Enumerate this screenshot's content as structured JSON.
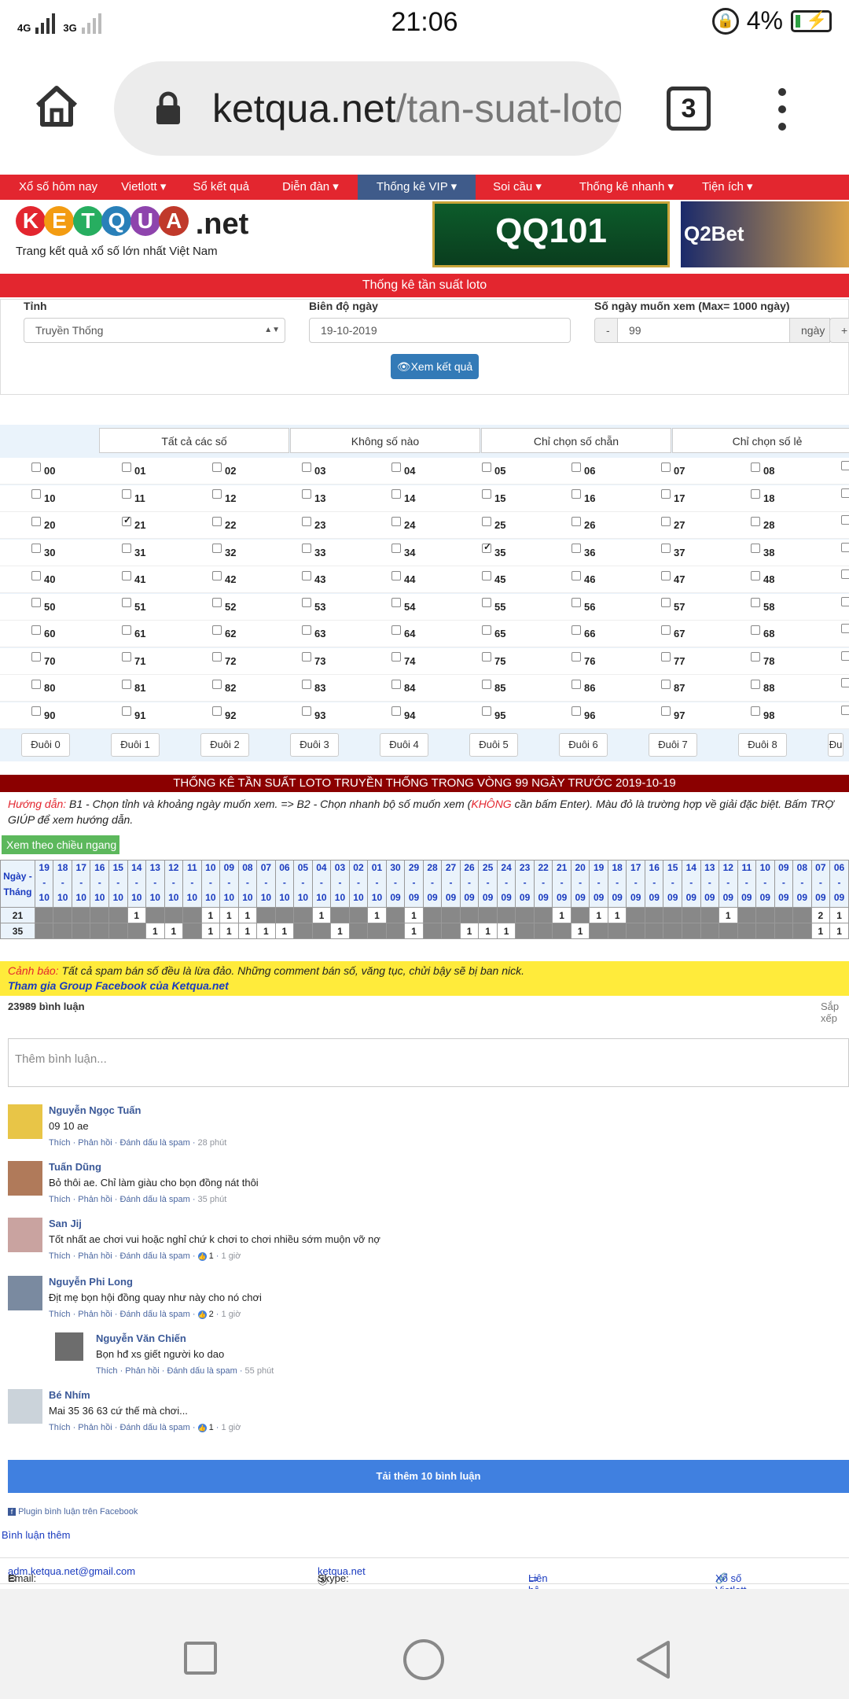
{
  "status_bar": {
    "network": "4G 3G",
    "time": "21:06",
    "battery": "4%"
  },
  "browser": {
    "url_host": "ketqua.net",
    "url_path": "/tan-suat-loto",
    "tab_count": "3"
  },
  "nav": [
    "Xổ số hôm nay",
    "Vietlott",
    "Sổ kết quả",
    "Diễn đàn",
    "Thống kê VIP",
    "Soi cầu",
    "Thống kê nhanh",
    "Tiện ích"
  ],
  "logo": {
    "letters": [
      "K",
      "E",
      "T",
      "Q",
      "U",
      "A"
    ],
    "suffix": ".net",
    "tagline": "Trang kết quả xổ số lớn nhất Việt Nam"
  },
  "ads": {
    "ad1": "QQ101",
    "ad2": "Q2Bet"
  },
  "page_title": "Thống kê tần suất loto",
  "form": {
    "province_label": "Tỉnh",
    "province_value": "Truyền Thống",
    "date_label": "Biên độ ngày",
    "date_value": "19-10-2019",
    "days_label": "Số ngày muốn xem (Max= 1000 ngày)",
    "days_value": "99",
    "minus": "-",
    "plus": "+",
    "unit": "ngày",
    "submit": "Xem kết quả"
  },
  "grid_header": [
    "Tất cả các số",
    "Không số nào",
    "Chỉ chọn số chẵn",
    "Chỉ chọn số lẻ"
  ],
  "numbers": [
    [
      "00",
      "01",
      "02",
      "03",
      "04",
      "05",
      "06",
      "07",
      "08"
    ],
    [
      "10",
      "11",
      "12",
      "13",
      "14",
      "15",
      "16",
      "17",
      "18"
    ],
    [
      "20",
      "21",
      "22",
      "23",
      "24",
      "25",
      "26",
      "27",
      "28"
    ],
    [
      "30",
      "31",
      "32",
      "33",
      "34",
      "35",
      "36",
      "37",
      "38"
    ],
    [
      "40",
      "41",
      "42",
      "43",
      "44",
      "45",
      "46",
      "47",
      "48"
    ],
    [
      "50",
      "51",
      "52",
      "53",
      "54",
      "55",
      "56",
      "57",
      "58"
    ],
    [
      "60",
      "61",
      "62",
      "63",
      "64",
      "65",
      "66",
      "67",
      "68"
    ],
    [
      "70",
      "71",
      "72",
      "73",
      "74",
      "75",
      "76",
      "77",
      "78"
    ],
    [
      "80",
      "81",
      "82",
      "83",
      "84",
      "85",
      "86",
      "87",
      "88"
    ],
    [
      "90",
      "91",
      "92",
      "93",
      "94",
      "95",
      "96",
      "97",
      "98"
    ]
  ],
  "checked": [
    "21",
    "35"
  ],
  "duoi": [
    "Đuôi 0",
    "Đuôi 1",
    "Đuôi 2",
    "Đuôi 3",
    "Đuôi 4",
    "Đuôi 5",
    "Đuôi 6",
    "Đuôi 7",
    "Đuôi 8",
    "Đu"
  ],
  "stats_title": "THỐNG KÊ TẦN SUẤT LOTO TRUYỀN THỐNG TRONG VÒNG 99 NGÀY TRƯỚC 2019-10-19",
  "guide": {
    "label": "Hướng dẫn:",
    "text1": " B1 - Chọn tỉnh và khoảng ngày muốn xem. => B2 - Chọn nhanh bộ số muốn xem (",
    "khong": "KHÔNG",
    "text2": " cần bấm Enter). Màu đỏ là trường hợp về giải đặc biệt. Bấm TRỢ GIÚP để xem hướng dẫn."
  },
  "horizontal_button": "Xem theo chiều ngang",
  "table": {
    "lead_label": "Ngày - Tháng",
    "days": [
      "19",
      "18",
      "17",
      "16",
      "15",
      "14",
      "13",
      "12",
      "11",
      "10",
      "09",
      "08",
      "07",
      "06",
      "05",
      "04",
      "03",
      "02",
      "01",
      "30",
      "29",
      "28",
      "27",
      "26",
      "25",
      "24",
      "23",
      "22",
      "21",
      "20",
      "19",
      "18",
      "17",
      "16",
      "15",
      "14",
      "13",
      "12",
      "11",
      "10",
      "09",
      "08",
      "07",
      "06"
    ],
    "months": [
      "10",
      "10",
      "10",
      "10",
      "10",
      "10",
      "10",
      "10",
      "10",
      "10",
      "10",
      "10",
      "10",
      "10",
      "10",
      "10",
      "10",
      "10",
      "10",
      "09",
      "09",
      "09",
      "09",
      "09",
      "09",
      "09",
      "09",
      "09",
      "09",
      "09",
      "09",
      "09",
      "09",
      "09",
      "09",
      "09",
      "09",
      "09",
      "09",
      "09",
      "09",
      "09",
      "09",
      "09"
    ],
    "rows": [
      {
        "num": "21",
        "cells": [
          "",
          "",
          "",
          "",
          "",
          "1",
          "",
          "",
          "",
          "1",
          "1",
          "1",
          "",
          "",
          "",
          "1",
          "",
          "",
          "1",
          "",
          "1",
          "",
          "",
          "",
          "",
          "",
          "",
          "",
          "1",
          "",
          "1",
          "1",
          "",
          "",
          "",
          "",
          "",
          "1",
          "",
          "",
          "",
          "",
          "2",
          "1"
        ]
      },
      {
        "num": "35",
        "cells": [
          "",
          "",
          "",
          "",
          "",
          "",
          "1",
          "1",
          "",
          "1",
          "1",
          "1",
          "1",
          "1",
          "",
          "",
          "1",
          "",
          "",
          "",
          "1",
          "",
          "",
          "1",
          "1",
          "1",
          "",
          "",
          "",
          "1",
          "",
          "",
          "",
          "",
          "",
          "",
          "",
          "",
          "",
          "",
          "",
          "",
          "1",
          "1"
        ]
      }
    ]
  },
  "warning": {
    "label": "Cảnh báo:",
    "text": " Tất cả spam bán số đều là lừa đảo. Những comment bán số, văng tục, chửi bậy sẽ bị ban nick.",
    "fb": "Tham gia Group Facebook của Ketqua.net"
  },
  "comments_count": "23989 bình luận",
  "sort_label": "Sắp xếp",
  "comment_placeholder": "Thêm bình luận...",
  "comments": [
    {
      "name": "Nguyễn Ngọc Tuấn",
      "text": "09 10 ae",
      "actions": "Thích · Phản hồi · Đánh dấu là spam · ",
      "time": "28 phút",
      "likes": ""
    },
    {
      "name": "Tuấn Dũng",
      "text": "Bỏ thôi ae. Chỉ làm giàu cho bọn đồng nát thôi",
      "actions": "Thích · Phản hồi · Đánh dấu là spam · ",
      "time": "35 phút",
      "likes": ""
    },
    {
      "name": "San Jij",
      "text": "Tốt nhất ae chơi vui hoặc nghỉ chứ k chơi to chơi nhiều sớm muộn vỡ nợ",
      "actions": "Thích · Phản hồi · Đánh dấu là spam · ",
      "time": "1 giờ",
      "likes": "1"
    },
    {
      "name": "Nguyễn Phi Long",
      "text": "Địt mẹ bọn hội đồng quay như này cho nó chơi",
      "actions": "Thích · Phản hồi · Đánh dấu là spam · ",
      "time": "1 giờ",
      "likes": "2"
    },
    {
      "name": "Nguyễn Văn Chiến",
      "text": "Bọn hđ xs giết người ko dao",
      "actions": "Thích · Phản hồi · Đánh dấu là spam · ",
      "time": "55 phút",
      "likes": ""
    },
    {
      "name": "Bé Nhím",
      "text": "Mai 35 36 63 cứ thế mà chơi...",
      "actions": "Thích · Phản hồi · Đánh dấu là spam · ",
      "time": "1 giờ",
      "likes": "1"
    }
  ],
  "load_more": "Tải thêm 10 bình luận",
  "plugin_label": "Plugin bình luận trên Facebook",
  "more_comments": "Bình luận thêm",
  "footer": {
    "email_label": "Email: ",
    "email": "adm.ketqua.net@gmail.com",
    "skype_label": "Skype: ",
    "skype": "ketqua.net",
    "ads": "Liên hệ quảng cáo",
    "vietlott": "Xổ số Vietlott"
  },
  "colors": {
    "brand_red": "#e3262f",
    "nav_active": "#3f5b8a",
    "dark_red": "#8b0000",
    "link_blue": "#1a3bbf",
    "button_blue": "#337ab7"
  }
}
